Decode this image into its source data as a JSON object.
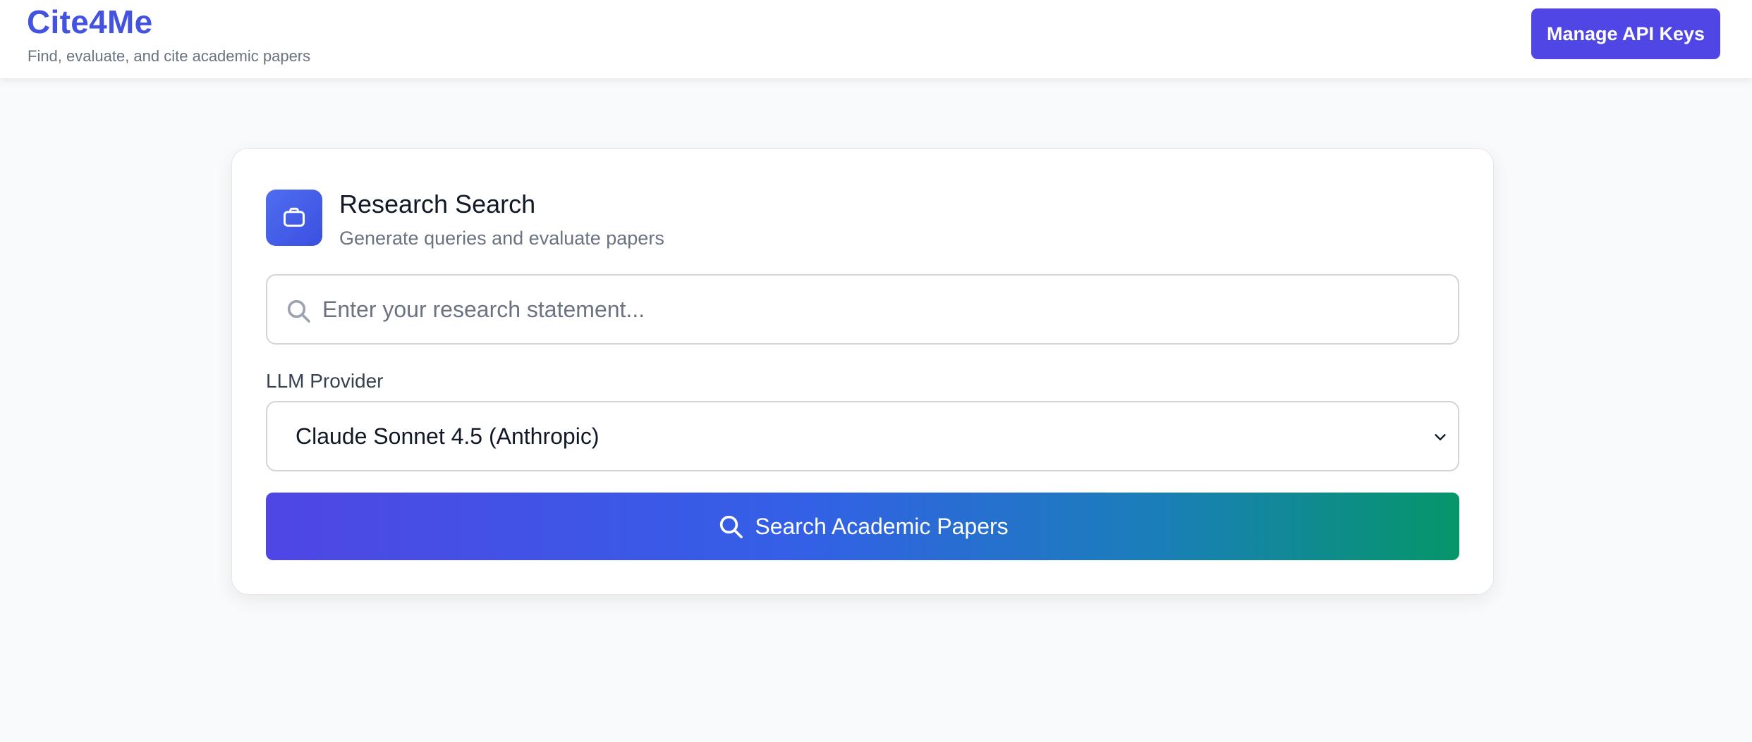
{
  "header": {
    "title": "Cite4Me",
    "tagline": "Find, evaluate, and cite academic papers",
    "api_button_label": "Manage API Keys"
  },
  "card": {
    "icon": "briefcase-icon",
    "title": "Research Search",
    "subtitle": "Generate queries and evaluate papers",
    "search": {
      "value": "",
      "placeholder": "Enter your research statement..."
    },
    "provider": {
      "label": "LLM Provider",
      "selected": "Claude Sonnet 4.5 (Anthropic)"
    },
    "search_button_label": "Search Academic Papers"
  },
  "colors": {
    "brand": "#4353e0",
    "primary_button": "#4f46e5",
    "gradient_start": "#4f46e5",
    "gradient_end": "#059669",
    "page_bg": "#f9fafb"
  }
}
